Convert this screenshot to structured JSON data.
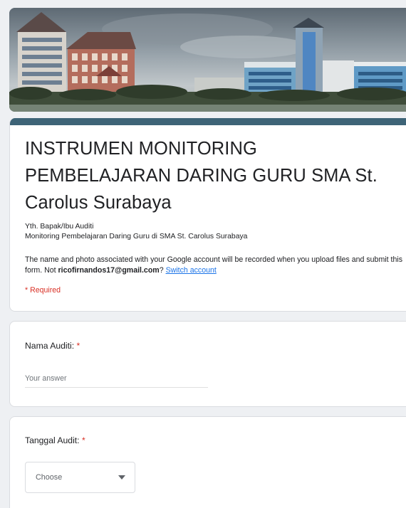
{
  "form": {
    "title": "INSTRUMEN MONITORING PEMBELAJARAN DARING GURU SMA St. Carolus Surabaya",
    "description_line1": "Yth. Bapak/Ibu Auditi",
    "description_line2": "Monitoring Pembelajaran Daring Guru di SMA St. Carolus Surabaya",
    "notice_prefix": "The name and photo associated with your Google account will be recorded when you upload files and submit this form. Not ",
    "account_email": "ricofirnandos17@gmail.com",
    "notice_suffix": "? ",
    "switch_account_label": "Switch account",
    "required_note": "* Required",
    "theme_color": "#3e6477",
    "required_color": "#d93025",
    "link_color": "#1a73e8"
  },
  "questions": [
    {
      "label": "Nama Auditi: ",
      "required_mark": "*",
      "placeholder": "Your answer"
    },
    {
      "label": "Tanggal Audit: ",
      "required_mark": "*",
      "selected": "Choose"
    }
  ]
}
